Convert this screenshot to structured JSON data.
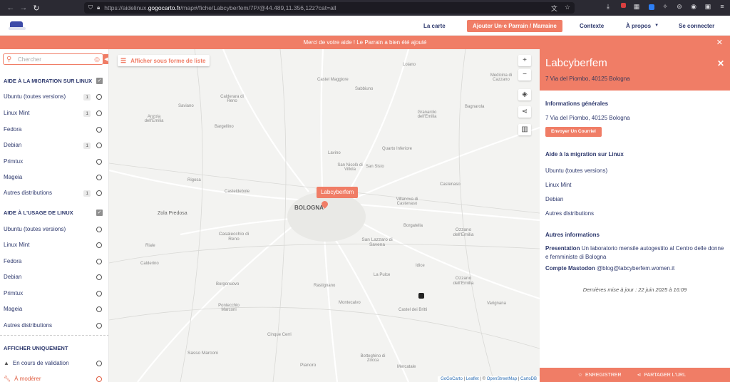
{
  "browser": {
    "url_host": "https://aidelinux.",
    "url_domain": "gogocarto.fr",
    "url_path": "/map#/fiche/Labcyberfem/7P/@44.489,11.356,12z?cat=all"
  },
  "header": {
    "nav": [
      "La carte",
      "Ajouter Un·e Parrain / Marraine",
      "Contexte",
      "À propos",
      "Se connecter"
    ]
  },
  "banner": {
    "text": "Merci de votre aide ! Le Parrain a bien été ajouté"
  },
  "sidebar": {
    "search_placeholder": "Chercher",
    "section1_title": "AIDE À LA MIGRATION SUR LINUX",
    "section1_items": [
      {
        "label": "Ubuntu (toutes versions)",
        "count": "1"
      },
      {
        "label": "Linux Mint",
        "count": "1"
      },
      {
        "label": "Fedora",
        "count": ""
      },
      {
        "label": "Debian",
        "count": "1"
      },
      {
        "label": "Primtux",
        "count": ""
      },
      {
        "label": "Mageia",
        "count": ""
      },
      {
        "label": "Autres distributions",
        "count": "1"
      }
    ],
    "section2_title": "AIDE À L'USAGE DE LINUX",
    "section2_items": [
      {
        "label": "Ubuntu (toutes versions)"
      },
      {
        "label": "Linux Mint"
      },
      {
        "label": "Fedora"
      },
      {
        "label": "Debian"
      },
      {
        "label": "Primtux"
      },
      {
        "label": "Mageia"
      },
      {
        "label": "Autres distributions"
      }
    ],
    "section3_title": "AFFICHER UNIQUEMENT",
    "section3_items": [
      {
        "label": "En cours de validation"
      },
      {
        "label": "À modérer"
      }
    ]
  },
  "map": {
    "list_button": "Afficher sous forme de liste",
    "marker_label": "Labcyberfem",
    "places": {
      "loiano": "Loiano",
      "castel_maggiore": "Castel Maggiore",
      "sabbiuno": "Sabbiuno",
      "calderara": "Calderara di Reno",
      "saviano": "Saviano",
      "bargellino": "Bargellino",
      "anzola": "Anzola dell'Emilia",
      "granarolo": "Granarolo dell'Emilia",
      "bagnarola": "Bagnarola",
      "quarto": "Quarto Inferiore",
      "medicina": "Medicina di Cazzano",
      "lavino": "Lavino",
      "rigosa": "Rigosa",
      "casteldebole": "Casteldebole",
      "bologna": "BOLOGNA",
      "san_nicolo": "San Nicolò di Villola",
      "san_sisto": "San Sisto",
      "villanova": "Villanova di Castenaso",
      "castenaso": "Castenaso",
      "zola": "Zola Predosa",
      "borgatella": "Borgatella",
      "casalecchio": "Casalecchio di Reno",
      "san_lazzaro": "San Lazzaro di Savena",
      "riale": "Riale",
      "idice": "Idice",
      "ozzano": "Ozzano dell'Emilia",
      "calderino": "Calderino",
      "la_pulce": "La Pulce",
      "borgonuovo": "Borgonuovo",
      "rastignano": "Rastignano",
      "pontecchio": "Pontecchio Marconi",
      "montecalvo": "Montecalvo",
      "castel_britti": "Castel dei Britti",
      "varignana": "Varignana",
      "sasso": "Sasso Marconi",
      "botteghino": "Botteghino di Zocca",
      "mercatale": "Mercatale",
      "pianoro": "Pianoro",
      "cinque_cerri": "Cinque Cerri"
    },
    "attribution": {
      "gogocarto": "GoGoCarto",
      "leaflet": "Leaflet",
      "copy": "©",
      "osm": "OpenStreetMap",
      "carto": "CartoDB"
    }
  },
  "panel": {
    "title": "Labcyberfem",
    "address": "7 Via del Piombo, 40125 Bologna",
    "general_title": "Informations générales",
    "general_address": "7 Via del Piombo, 40125 Bologna",
    "mail_button": "Envoyer Un Courriel",
    "migration_title": "Aide à la migration sur Linux",
    "migration_items": [
      "Ubuntu (toutes versions)",
      "Linux Mint",
      "Debian",
      "Autres distributions"
    ],
    "other_title": "Autres informations",
    "presentation_label": "Presentation",
    "presentation_text": "Un laboratorio mensile autogestito al Centro delle donne e femministe di Bologna",
    "mastodon_label": "Compte Mastodon",
    "mastodon_value": "@blog@labcyberfem.women.it",
    "updated": "Dernières mise à jour : 22 juin 2025 à 16:09",
    "save_label": "ENREGISTRER",
    "share_label": "PARTAGER L'URL"
  },
  "colors": {
    "accent": "#f07d66",
    "navy": "#2f3a6e"
  }
}
